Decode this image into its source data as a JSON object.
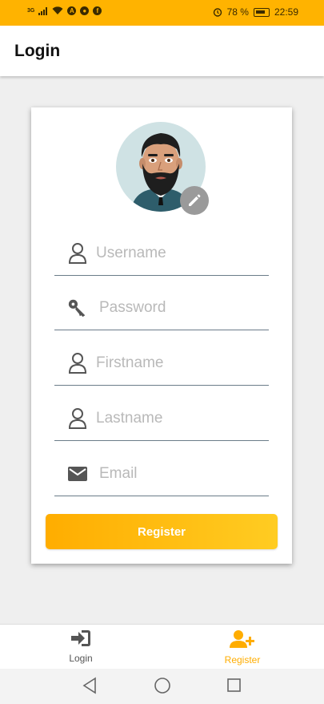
{
  "status_bar": {
    "network": "3G",
    "battery_percent": "78 %",
    "time": "22:59"
  },
  "app_bar": {
    "title": "Login"
  },
  "form": {
    "fields": [
      {
        "placeholder": "Username",
        "icon": "person-icon"
      },
      {
        "placeholder": "Password",
        "icon": "key-icon"
      },
      {
        "placeholder": "Firstname",
        "icon": "person-icon"
      },
      {
        "placeholder": "Lastname",
        "icon": "person-icon"
      },
      {
        "placeholder": "Email",
        "icon": "mail-icon"
      }
    ],
    "register_label": "Register"
  },
  "bottom_nav": {
    "items": [
      {
        "label": "Login",
        "icon": "login-icon",
        "active": false
      },
      {
        "label": "Register",
        "icon": "add-user-icon",
        "active": true
      }
    ]
  },
  "colors": {
    "accent": "#ffb300",
    "inactive": "#555555"
  }
}
